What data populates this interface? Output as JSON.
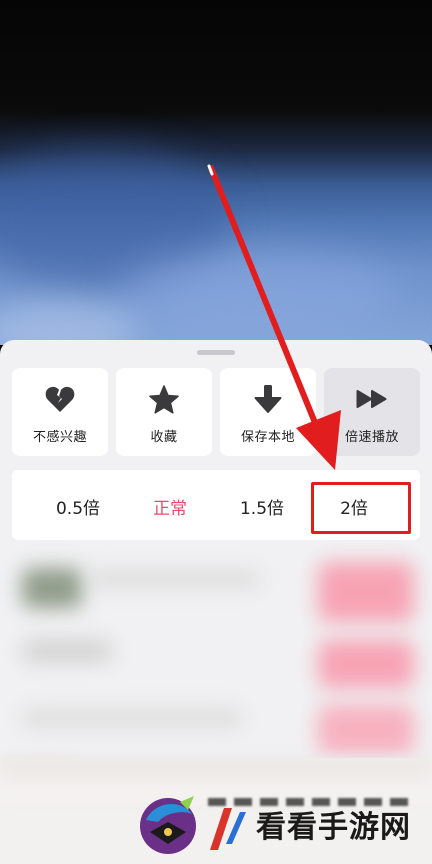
{
  "actions": [
    {
      "label": "不感兴趣",
      "icon": "broken-heart-icon"
    },
    {
      "label": "收藏",
      "icon": "star-icon"
    },
    {
      "label": "保存本地",
      "icon": "download-arrow-icon"
    },
    {
      "label": "倍速播放",
      "icon": "fast-forward-icon"
    }
  ],
  "speed": {
    "options": [
      "0.5倍",
      "正常",
      "1.5倍",
      "2倍"
    ],
    "selected": "正常"
  },
  "watermark": {
    "text": "看看手游网"
  },
  "colors": {
    "accent": "#f0456e",
    "highlight": "#e11d1d",
    "sheet_bg": "#f1f1f3"
  }
}
